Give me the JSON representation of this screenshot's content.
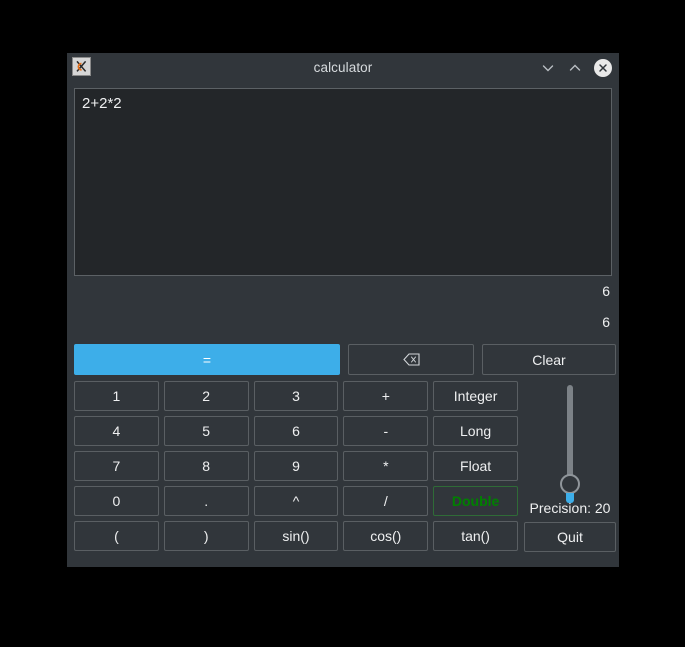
{
  "window": {
    "title": "calculator",
    "app_icon": "x11-app-icon",
    "controls": {
      "minimize": "chevron-down-icon",
      "maximize": "chevron-up-icon",
      "close": "close-icon"
    }
  },
  "display": {
    "expression": "2+2*2"
  },
  "results": [
    "6",
    "6"
  ],
  "actions": {
    "equals_label": "=",
    "backspace_label": "⌫",
    "clear_label": "Clear"
  },
  "keypad": {
    "rows": [
      [
        "1",
        "2",
        "3",
        "+",
        "Integer"
      ],
      [
        "4",
        "5",
        "6",
        "-",
        "Long"
      ],
      [
        "7",
        "8",
        "9",
        "*",
        "Float"
      ],
      [
        "0",
        ".",
        "^",
        "/",
        "Double"
      ],
      [
        "(",
        ")",
        "sin()",
        "cos()",
        "tan()"
      ]
    ],
    "selected_type": "Double"
  },
  "precision": {
    "label": "Precision: 20",
    "value": 20
  },
  "quit": {
    "label": "Quit"
  },
  "colors": {
    "window_bg": "#31363b",
    "display_bg": "#232629",
    "accent_blue": "#3daee9",
    "selected_green": "#008000",
    "text": "#eff0f1",
    "border": "#5a5f63",
    "desktop_bg": "#000000"
  }
}
